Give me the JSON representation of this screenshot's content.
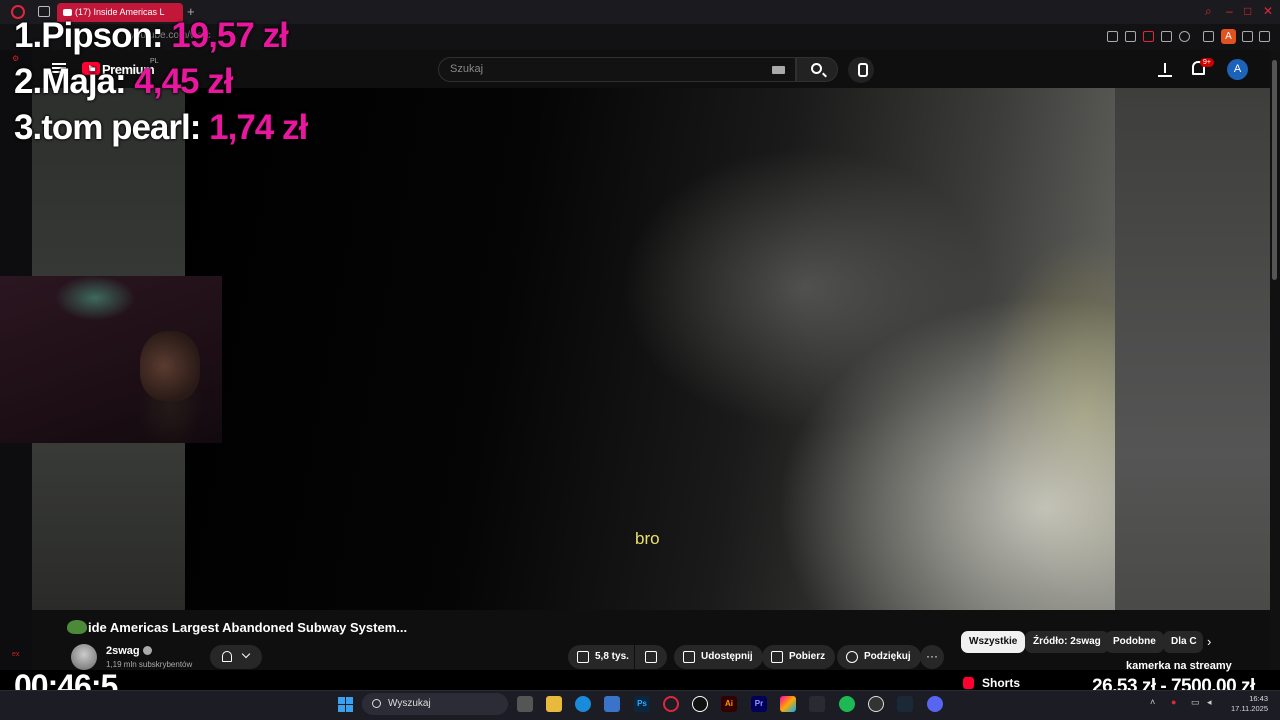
{
  "browser": {
    "tab_title": "(17) Inside Americas L",
    "url": "youtube.com/watc",
    "new_tab": "+",
    "win_min": "–",
    "win_max": "□",
    "win_close": "✕",
    "ext_badge": "A"
  },
  "youtube": {
    "logo_text": "Premium",
    "region": "PL",
    "search_placeholder": "Szukaj",
    "notif_count": "9+",
    "account_initial": "A"
  },
  "overlay": {
    "leaderboard": [
      {
        "rank": "1.",
        "name": "Pipson:",
        "amount": "19,57 zł"
      },
      {
        "rank": "2.",
        "name": "Maja:",
        "amount": "4,45 zł"
      },
      {
        "rank": "3.",
        "name": "tom pearl:",
        "amount": "1,74 zł"
      }
    ],
    "timer": "00:46:5",
    "goal_title": "kamerka na streamy",
    "goal_value": "26,53 zł - 7500,00 zł",
    "small_label": "ex"
  },
  "video": {
    "subtitle": "bro",
    "title": "ide Americas Largest Abandoned Subway System...",
    "channel_name": "2swag",
    "subscribers": "1,19 mln subskrybentów",
    "likes": "5,8 tys.",
    "share": "Udostępnij",
    "download": "Pobierz",
    "thanks": "Podziękuj",
    "more": "···"
  },
  "chips": [
    "Wszystkie",
    "Źródło: 2swag",
    "Podobne",
    "Dla C"
  ],
  "shorts_label": "Shorts",
  "taskbar": {
    "search_label": "Wyszukaj",
    "apps": [
      "Ps",
      "Ai",
      "Pr"
    ],
    "time": "16:43",
    "date": "17.11.2025"
  },
  "colors": {
    "accent_donation": "#e8179e",
    "subtitle": "#e8e26a",
    "opera_red": "#e0263c",
    "youtube_red": "#ff0033"
  }
}
